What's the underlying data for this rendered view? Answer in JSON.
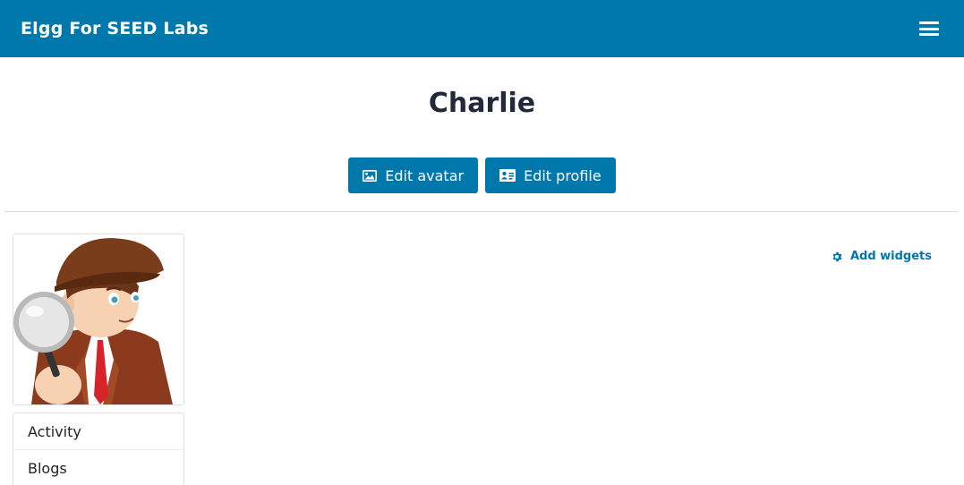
{
  "header": {
    "site_name": "Elgg For SEED Labs",
    "menu_icon": "hamburger-icon",
    "bg_color": "#0078ac"
  },
  "profile": {
    "name": "Charlie",
    "avatar_alt": "detective-avatar"
  },
  "actions": {
    "edit_avatar": "Edit avatar",
    "edit_avatar_icon": "image-icon",
    "edit_profile": "Edit profile",
    "edit_profile_icon": "id-card-icon"
  },
  "widgets": {
    "add_label": "Add widgets",
    "add_icon": "gear-icon"
  },
  "owner_menu": {
    "items": [
      {
        "label": "Activity"
      },
      {
        "label": "Blogs"
      }
    ]
  }
}
